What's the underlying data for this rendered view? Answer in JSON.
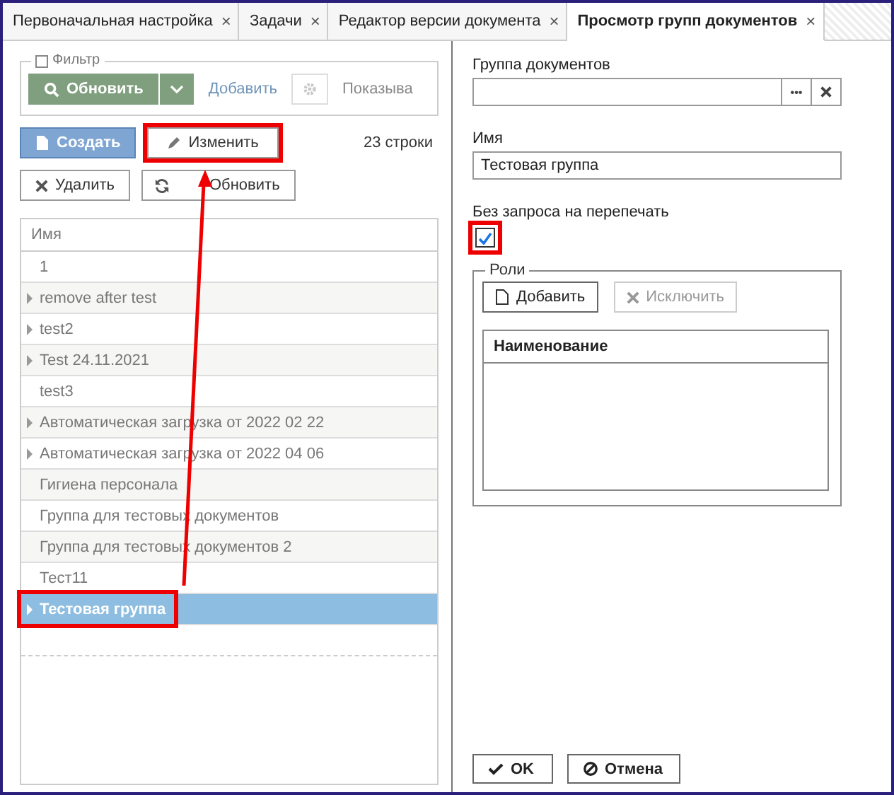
{
  "tabs": [
    {
      "label": "Первоначальная настройка",
      "selected": false,
      "close": "×"
    },
    {
      "label": "Задачи",
      "selected": false,
      "close": "×"
    },
    {
      "label": "Редактор версии документа",
      "selected": false,
      "close": "×"
    },
    {
      "label": "Просмотр групп документов",
      "selected": true,
      "close": "×"
    }
  ],
  "filter": {
    "legend": "Фильтр",
    "refresh": {
      "label": "Обновить",
      "disabled": true
    },
    "add": {
      "label": "Добавить",
      "disabled": true
    },
    "show": "Показыва"
  },
  "toolbar": {
    "create": {
      "label": "Создать",
      "highlighted": false
    },
    "edit": {
      "label": "Изменить",
      "highlighted": true
    },
    "count": "23 строки",
    "delete": {
      "label": "Удалить"
    },
    "refresh": {
      "label": "Обновить"
    }
  },
  "list": {
    "column": "Имя",
    "rows": [
      {
        "name": "1",
        "has_children": false,
        "selected": false,
        "highlighted": false
      },
      {
        "name": "remove after test",
        "has_children": true,
        "selected": false,
        "highlighted": false
      },
      {
        "name": "test2",
        "has_children": true,
        "selected": false,
        "highlighted": false
      },
      {
        "name": "Test 24.11.2021",
        "has_children": true,
        "selected": false,
        "highlighted": false
      },
      {
        "name": "test3",
        "has_children": false,
        "selected": false,
        "highlighted": false
      },
      {
        "name": "Автоматическая загрузка от 2022 02 22",
        "has_children": true,
        "selected": false,
        "highlighted": false
      },
      {
        "name": "Автоматическая загрузка от 2022 04 06",
        "has_children": true,
        "selected": false,
        "highlighted": false
      },
      {
        "name": "Гигиена персонала",
        "has_children": false,
        "selected": false,
        "highlighted": false
      },
      {
        "name": "Группа для тестовых документов",
        "has_children": false,
        "selected": false,
        "highlighted": false
      },
      {
        "name": "Группа для тестовых документов 2",
        "has_children": false,
        "selected": false,
        "highlighted": false
      },
      {
        "name": "Тест11",
        "has_children": false,
        "selected": false,
        "highlighted": false
      },
      {
        "name": "Тестовая группа",
        "has_children": true,
        "selected": true,
        "highlighted": true
      }
    ]
  },
  "form": {
    "group_label": "Группа документов",
    "group_more": "•••",
    "name_label": "Имя",
    "name_value": "Тестовая группа",
    "reprint_label": "Без запроса на перепечать",
    "reprint_checked": true,
    "reprint_highlighted": true,
    "roles": {
      "legend": "Роли",
      "add": {
        "label": "Добавить",
        "disabled": false
      },
      "exclude": {
        "label": "Исключить",
        "disabled": true
      },
      "column": "Наименование"
    }
  },
  "buttons": {
    "ok": "OK",
    "cancel": "Отмена"
  }
}
